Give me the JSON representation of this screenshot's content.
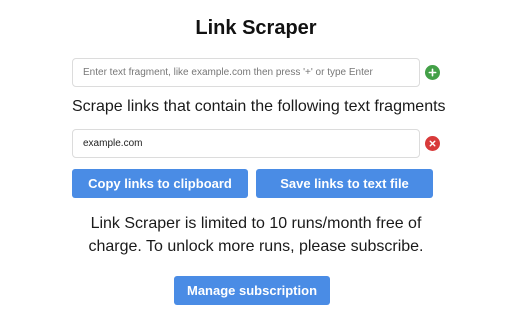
{
  "app": {
    "title": "Link Scraper"
  },
  "add_fragment": {
    "placeholder": "Enter text fragment, like example.com then press '+' or type Enter",
    "value": "",
    "add_icon": "plus-icon",
    "add_color": "#43a047"
  },
  "instruction": "Scrape links that contain the following text fragments",
  "fragments": [
    {
      "value": "example.com",
      "remove_icon": "close-icon",
      "remove_color": "#d83a3a"
    }
  ],
  "actions": {
    "copy_label": "Copy links to clipboard",
    "save_label": "Save links to text file",
    "accent_color": "#4a8ce5"
  },
  "notice": {
    "line1": "Link Scraper is limited to 10 runs/month free of",
    "line2": "charge. To unlock more runs, please subscribe."
  },
  "subscription": {
    "manage_label": "Manage subscription"
  }
}
